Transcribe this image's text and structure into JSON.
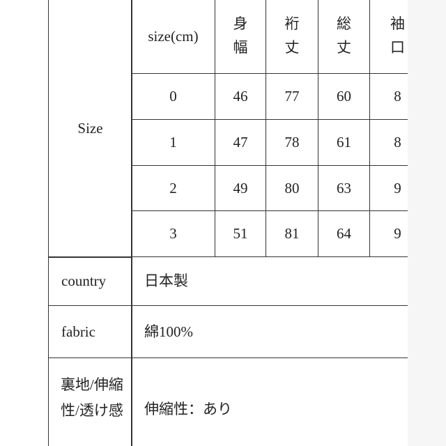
{
  "size_table": {
    "row_label": "Size",
    "header": [
      "size(cm)",
      "身\n幅",
      "裄\n丈",
      "総\n丈",
      "袖\n口"
    ],
    "rows": [
      [
        "0",
        "46",
        "77",
        "60",
        "8"
      ],
      [
        "1",
        "47",
        "78",
        "61",
        "8"
      ],
      [
        "2",
        "49",
        "80",
        "63",
        "9"
      ],
      [
        "3",
        "51",
        "81",
        "64",
        "9"
      ]
    ]
  },
  "details": [
    {
      "label": "country",
      "value": "日本製"
    },
    {
      "label": "fabric",
      "value": "綿100%"
    },
    {
      "label": "裏地/伸縮性/透け感",
      "value": "伸縮性：あり"
    }
  ]
}
